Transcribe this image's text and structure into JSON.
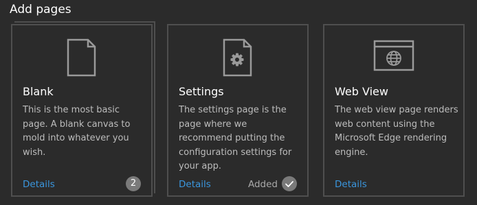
{
  "page": {
    "title": "Add pages"
  },
  "cards": [
    {
      "title": "Blank",
      "description": "This is the most basic page. A blank canvas to mold into whatever you wish.",
      "icon": "blank-page-icon",
      "details_label": "Details",
      "count": "2"
    },
    {
      "title": "Settings",
      "description": "The settings page is the page where we recommend putting the configuration settings for your app.",
      "icon": "settings-page-icon",
      "details_label": "Details",
      "status": "Added",
      "status_icon": "checkmark-icon"
    },
    {
      "title": "Web View",
      "description": "The web view page renders web content using the Microsoft Edge rendering engine.",
      "icon": "web-view-icon",
      "details_label": "Details"
    }
  ],
  "colors": {
    "background": "#2b2b2b",
    "card_border": "#4f4f4f",
    "link": "#3a96dd",
    "muted_text": "#bdbdbd",
    "badge": "#7a7a7a"
  }
}
